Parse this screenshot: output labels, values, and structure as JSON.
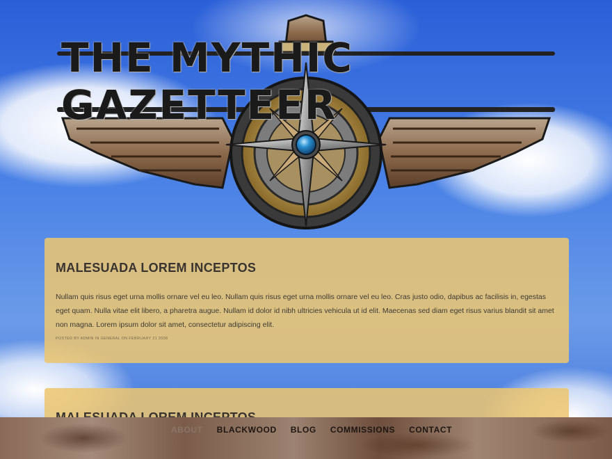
{
  "header": {
    "site_title": "THE MYTHIC GAZETTEER"
  },
  "posts": [
    {
      "title": "MALESUADA LOREM INCEPTOS",
      "body": "Nullam quis risus eget urna mollis ornare vel eu leo. Nullam quis risus eget urna mollis ornare vel eu leo. Cras justo odio, dapibus ac facilisis in, egestas eget quam. Nulla vitae elit libero, a pharetra augue. Nullam id dolor id nibh ultricies vehicula ut id elit. Maecenas sed diam eget risus varius blandit sit amet non magna. Lorem ipsum dolor sit amet, consectetur adipiscing elit.",
      "meta": "POSTED BY ADMIN IN GENERAL ON FEBRUARY 21 2008"
    },
    {
      "title": "MALESUADA LOREM INCEPTOS"
    }
  ],
  "nav": {
    "items": [
      "ABOUT",
      "BLACKWOOD",
      "BLOG",
      "COMMISSIONS",
      "CONTACT"
    ]
  },
  "colors": {
    "sky": "#4a82e6",
    "post_bg": "#ecc670",
    "footer_rust": "#8a6a58",
    "compass_gem": "#2a8ed0"
  }
}
